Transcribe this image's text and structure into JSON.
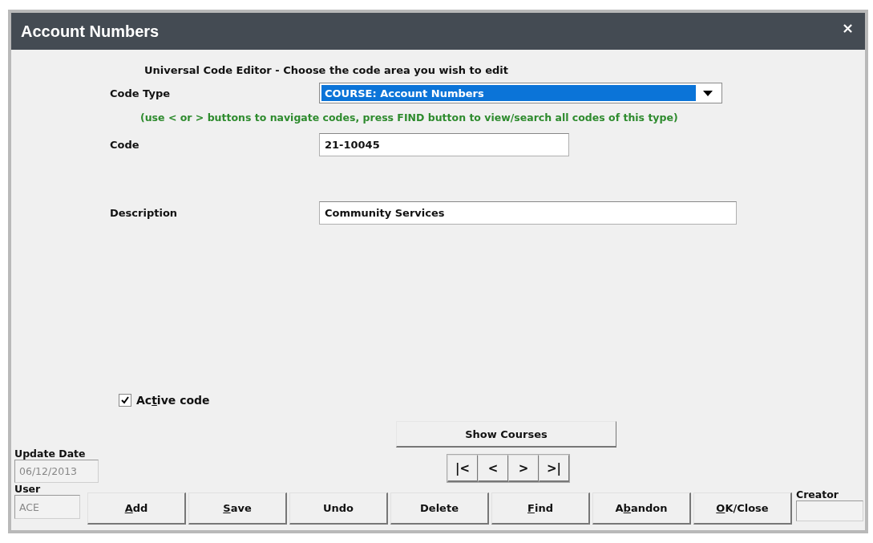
{
  "window": {
    "title": "Account Numbers",
    "close": "×"
  },
  "heading": "Universal Code Editor - Choose the code area you wish to edit",
  "code_type": {
    "label": "Code Type",
    "value": "COURSE: Account Numbers"
  },
  "hint": "(use < or > buttons to navigate codes, press FIND button to view/search all codes of this type)",
  "code": {
    "label": "Code",
    "value": "21-10045"
  },
  "description": {
    "label": "Description",
    "value": "Community Services"
  },
  "active_code": {
    "label": [
      {
        "text": "Ac",
        "underlined": false
      },
      {
        "text": "t",
        "underlined": true
      },
      {
        "text": "ive code",
        "underlined": false
      }
    ],
    "checked": true
  },
  "show_courses": "Show Courses",
  "navigation": [
    "|<",
    "<",
    ">",
    ">|"
  ],
  "update_date": {
    "label": "Update Date",
    "value": "06/12/2013"
  },
  "user": {
    "label": "User",
    "value": "ACE"
  },
  "buttons": [
    {
      "label": [
        {
          "text": "A",
          "underlined": true
        },
        {
          "text": "dd",
          "underlined": false
        }
      ]
    },
    {
      "label": [
        {
          "text": "S",
          "underlined": true
        },
        {
          "text": "ave",
          "underlined": false
        }
      ]
    },
    {
      "label": [
        {
          "text": "Undo",
          "underlined": false
        }
      ]
    },
    {
      "label": [
        {
          "text": "Delete",
          "underlined": false
        }
      ]
    },
    {
      "label": [
        {
          "text": "F",
          "underlined": true
        },
        {
          "text": "ind",
          "underlined": false
        }
      ]
    },
    {
      "label": [
        {
          "text": "A",
          "underlined": false
        },
        {
          "text": "b",
          "underlined": true
        },
        {
          "text": "andon",
          "underlined": false
        }
      ]
    },
    {
      "label": [
        {
          "text": "O",
          "underlined": true
        },
        {
          "text": "K/Close",
          "underlined": false
        }
      ]
    }
  ],
  "creator": {
    "label": "Creator"
  }
}
